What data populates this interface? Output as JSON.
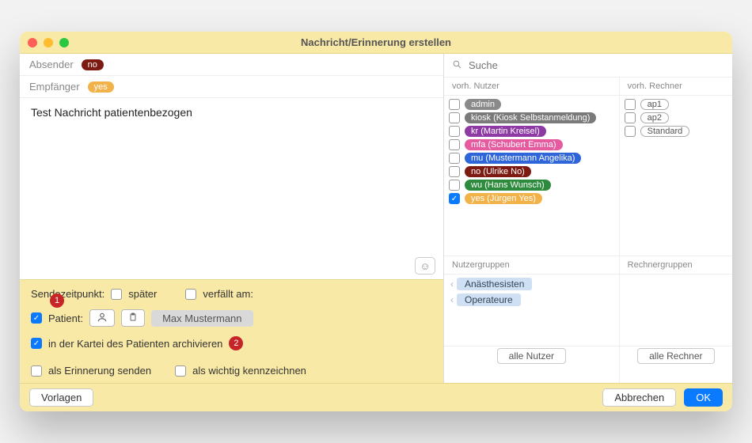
{
  "title": "Nachricht/Erinnerung erstellen",
  "sender": {
    "label": "Absender",
    "value": "no"
  },
  "recipient": {
    "label": "Empfänger",
    "value": "yes"
  },
  "message": "Test Nachricht patientenbezogen",
  "send_time": {
    "label": "Sendezeitpunkt:",
    "later_label": "später",
    "expires_label": "verfällt am:"
  },
  "patient": {
    "checkbox_label": "Patient:",
    "name": "Max Mustermann",
    "archive_label": "in der Kartei des Patienten archivieren"
  },
  "flags": {
    "reminder_label": "als Erinnerung senden",
    "important_label": "als wichtig kennzeichnen"
  },
  "markers": {
    "one": "1",
    "two": "2"
  },
  "search": {
    "placeholder": "Suche"
  },
  "users_header": "vorh. Nutzer",
  "machines_header": "vorh. Rechner",
  "users": [
    {
      "label": "admin",
      "color": "grey",
      "checked": false
    },
    {
      "label": "kiosk (Kiosk Selbstanmeldung)",
      "color": "darkgrey",
      "checked": false
    },
    {
      "label": "kr (Martin Kreisel)",
      "color": "purple",
      "checked": false
    },
    {
      "label": "mfa (Schubert Emma)",
      "color": "pink",
      "checked": false
    },
    {
      "label": "mu (Mustermann Angelika)",
      "color": "blue",
      "checked": false
    },
    {
      "label": "no (Ulrike No)",
      "color": "red",
      "checked": false
    },
    {
      "label": "wu (Hans Wunsch)",
      "color": "green",
      "checked": false
    },
    {
      "label": "yes (Jürgen Yes)",
      "color": "yesgold",
      "checked": true
    }
  ],
  "machines": [
    {
      "label": "ap1"
    },
    {
      "label": "ap2"
    },
    {
      "label": "Standard"
    }
  ],
  "user_groups_header": "Nutzergruppen",
  "machine_groups_header": "Rechnergruppen",
  "user_groups": [
    "Anästhesisten",
    "Operateure"
  ],
  "all_users_label": "alle Nutzer",
  "all_machines_label": "alle Rechner",
  "buttons": {
    "templates": "Vorlagen",
    "cancel": "Abbrechen",
    "ok": "OK"
  }
}
